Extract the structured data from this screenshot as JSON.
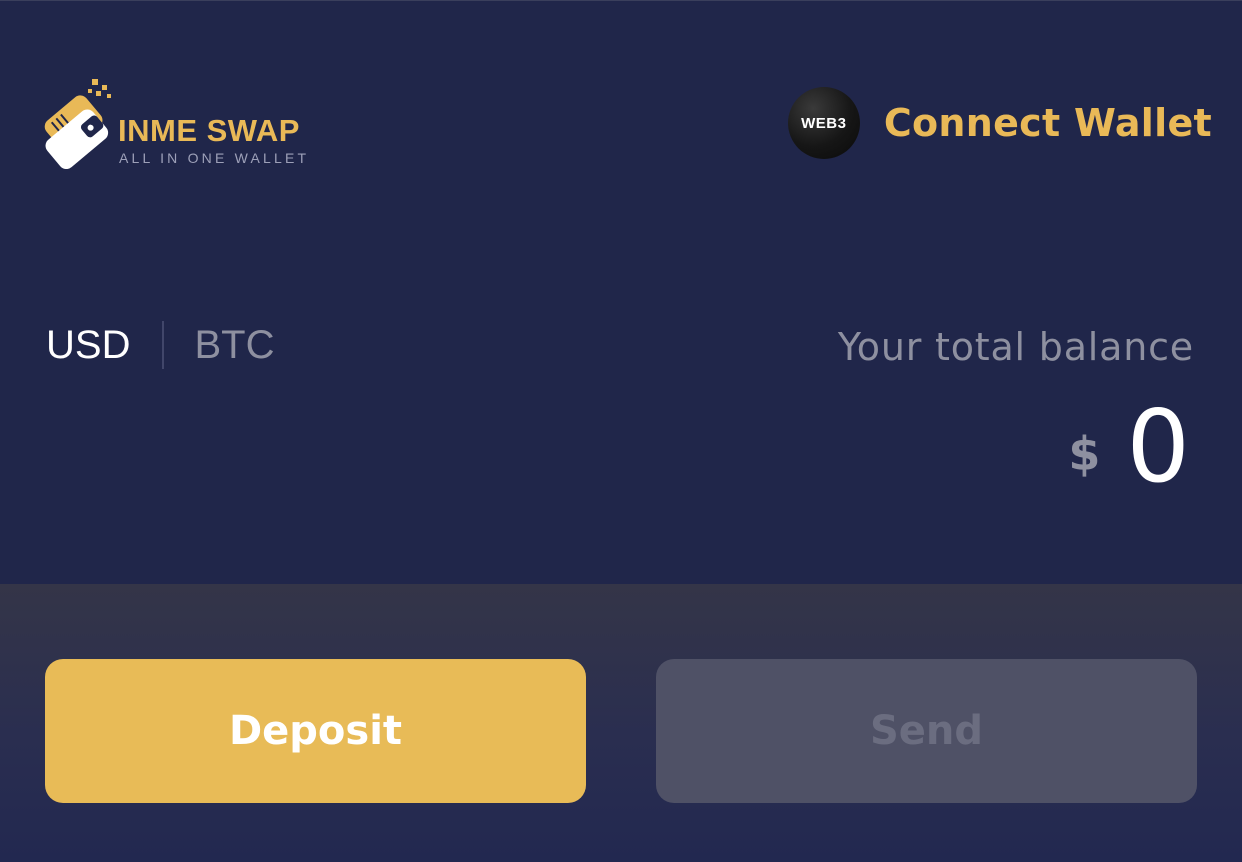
{
  "header": {
    "logo": {
      "title_part1": "INME",
      "title_part2": "SWAP",
      "tagline": "ALL IN ONE WALLET",
      "icon": "wallet-icon"
    },
    "connect_wallet": {
      "badge_text": "WEB3",
      "label": "Connect Wallet"
    }
  },
  "currency_toggle": {
    "options": [
      "USD",
      "BTC"
    ],
    "selected": "USD"
  },
  "balance": {
    "label": "Your total balance",
    "currency_symbol": "$",
    "value": "0"
  },
  "actions": {
    "deposit_label": "Deposit",
    "send_label": "Send"
  },
  "colors": {
    "background": "#20264a",
    "accent": "#e8bb57",
    "muted_text": "#8e90a0",
    "disabled_button": "#4f5166"
  }
}
